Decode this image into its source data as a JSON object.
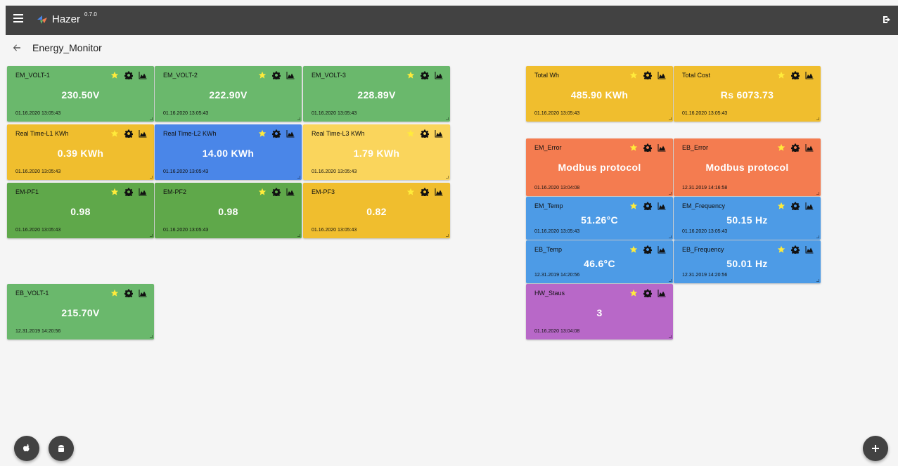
{
  "app": {
    "name": "Hazer",
    "version": "0.7.0"
  },
  "page": {
    "title": "Energy_Monitor"
  },
  "colors": {
    "green": "#6ab86c",
    "green_dark": "#5fa84a",
    "yellow": "#f0be2e",
    "yellow_light": "#fad55c",
    "blue": "#4a86e8",
    "orange": "#f47c50",
    "sky": "#4d9be6",
    "purple": "#b868c8"
  },
  "tiles": [
    {
      "name": "EM_VOLT-1",
      "value": "230.50V",
      "time": "01.16.2020 13:05:43",
      "color": "#6ab86c"
    },
    {
      "name": "EM_VOLT-2",
      "value": "222.90V",
      "time": "01.16.2020 13:05:43",
      "color": "#6ab86c"
    },
    {
      "name": "EM_VOLT-3",
      "value": "228.89V",
      "time": "01.16.2020 13:05:43",
      "color": "#6ab86c"
    },
    {
      "name": "Real Time-L1 KWh",
      "value": "0.39 KWh",
      "time": "01.16.2020 13:05:43",
      "color": "#f0be2e"
    },
    {
      "name": "Real Time-L2 KWh",
      "value": "14.00 KWh",
      "time": "01.16.2020 13:05:43",
      "color": "#4a86e8"
    },
    {
      "name": "Real Time-L3 KWh",
      "value": "1.79 KWh",
      "time": "01.16.2020 13:05:43",
      "color": "#fad55c"
    },
    {
      "name": "EM-PF1",
      "value": "0.98",
      "time": "01.16.2020 13:05:43",
      "color": "#5fa84a"
    },
    {
      "name": "EM-PF2",
      "value": "0.98",
      "time": "01.16.2020 13:05:43",
      "color": "#5fa84a"
    },
    {
      "name": "EM-PF3",
      "value": "0.82",
      "time": "01.16.2020 13:05:43",
      "color": "#f0be2e"
    },
    {
      "name": "EB_VOLT-1",
      "value": "215.70V",
      "time": "12.31.2019 14:20:56",
      "color": "#6ab86c"
    },
    {
      "name": "Total Wh",
      "value": "485.90 KWh",
      "time": "01.16.2020 13:05:43",
      "color": "#f0be2e"
    },
    {
      "name": "Total Cost",
      "value": "Rs 6073.73",
      "time": "01.16.2020 13:05:43",
      "color": "#f0be2e"
    },
    {
      "name": "EM_Error",
      "value": "Modbus protocol",
      "time": "01.16.2020 13:04:08",
      "color": "#f47c50"
    },
    {
      "name": "EB_Error",
      "value": "Modbus protocol",
      "time": "12.31.2019 14:16:58",
      "color": "#f47c50"
    },
    {
      "name": "EM_Temp",
      "value": "51.26°C",
      "time": "01.16.2020 13:05:43",
      "color": "#4d9be6"
    },
    {
      "name": "EM_Frequency",
      "value": "50.15 Hz",
      "time": "01.16.2020 13:05:43",
      "color": "#4d9be6"
    },
    {
      "name": "EB_Temp",
      "value": "46.6°C",
      "time": "12.31.2019 14:20:56",
      "color": "#4d9be6"
    },
    {
      "name": "EB_Frequency",
      "value": "50.01 Hz",
      "time": "12.31.2019 14:20:56",
      "color": "#4d9be6"
    },
    {
      "name": "HW_Staus",
      "value": "3",
      "time": "01.16.2020 13:04:08",
      "color": "#b868c8"
    }
  ],
  "icons": {
    "menu": "menu-icon",
    "logo": "hazer-logo-icon",
    "logout": "logout-icon",
    "back": "arrow-left-icon",
    "star": "star-icon",
    "settings": "gear-icon",
    "chart": "area-chart-icon",
    "apple": "apple-icon",
    "android": "android-icon",
    "add": "plus-icon"
  }
}
